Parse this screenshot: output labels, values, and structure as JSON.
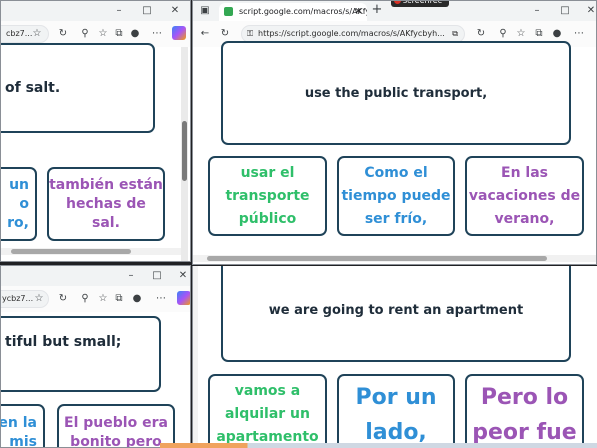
{
  "left_top_window": {
    "url_fragment": "cbz7...",
    "visible_text": "of salt.",
    "cards": [
      {
        "text": "un\no\nro,",
        "color": "blue"
      },
      {
        "text": "también están\nhechas de\nsal.",
        "color": "purple"
      }
    ]
  },
  "left_bottom_window": {
    "url_fragment": "ycbz7...",
    "visible_text": "tiful but small;",
    "cards": [
      {
        "text": "en la\nmis",
        "color": "blue"
      },
      {
        "text": "El pueblo era\nbonito pero",
        "color": "purple"
      }
    ]
  },
  "right_top_window": {
    "tab_title": "script.google.com/macros/s/AKfy",
    "address": "https://script.google.com/macros/s/AKfycbyh...",
    "prompt": "use the public transport,",
    "cards": [
      {
        "text": "usar el\ntransporte\npúblico",
        "color": "green"
      },
      {
        "text": "Como el\ntiempo puede\nser frío,",
        "color": "blue"
      },
      {
        "text": "En las\nvacaciones de\nverano,",
        "color": "purple"
      }
    ]
  },
  "right_bottom_window": {
    "prompt": "we are going to rent an apartment",
    "cards": [
      {
        "text": "vamos a\nalquilar un\napartamento",
        "color": "green"
      },
      {
        "text": "Por un\nlado,",
        "color": "blue"
      },
      {
        "text": "Pero lo\npeor fue",
        "color": "purple"
      }
    ]
  },
  "overlay": {
    "recorder_label": "screenrec"
  },
  "toolbar_icons": [
    "back-arrow-icon",
    "reload-icon",
    "tracking-icon",
    "favorite-star-icon",
    "collections-icon",
    "profile-icon",
    "more-icon",
    "copilot-icon"
  ],
  "colors": {
    "green": "#2fbf6a",
    "blue": "#2f8fd6",
    "purple": "#9b55b5",
    "card_border": "#1f4359",
    "recorder_red": "#d93025"
  }
}
